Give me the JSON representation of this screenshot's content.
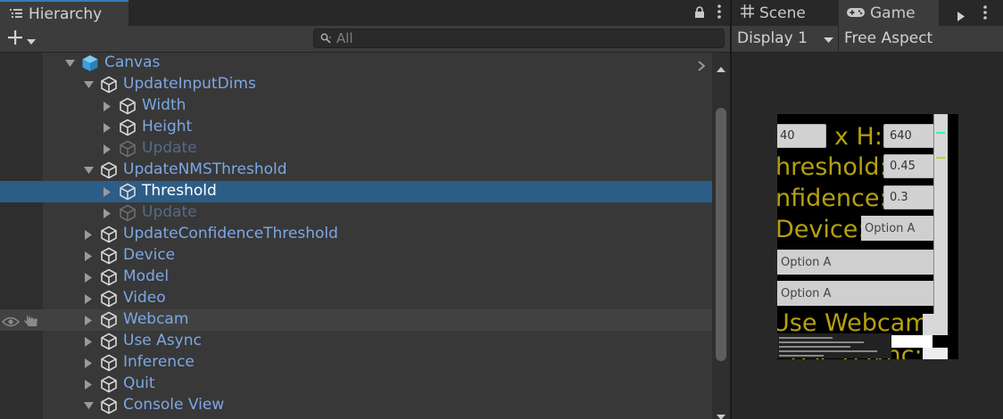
{
  "hierarchy": {
    "tab_title": "Hierarchy",
    "search_placeholder": "All",
    "rows": [
      {
        "name": "Canvas",
        "indent": 0,
        "fold": "open",
        "icon": "canvas-icon",
        "state": "normal"
      },
      {
        "name": "UpdateInputDims",
        "indent": 1,
        "fold": "open",
        "icon": "gameobject-icon",
        "state": "normal"
      },
      {
        "name": "Width",
        "indent": 2,
        "fold": "closed",
        "icon": "gameobject-icon",
        "state": "normal"
      },
      {
        "name": "Height",
        "indent": 2,
        "fold": "closed",
        "icon": "gameobject-icon",
        "state": "normal"
      },
      {
        "name": "Update",
        "indent": 2,
        "fold": "closed",
        "icon": "gameobject-icon",
        "state": "disabled"
      },
      {
        "name": "UpdateNMSThreshold",
        "indent": 1,
        "fold": "open",
        "icon": "gameobject-icon",
        "state": "normal"
      },
      {
        "name": "Threshold",
        "indent": 2,
        "fold": "closed",
        "icon": "gameobject-icon",
        "state": "selected"
      },
      {
        "name": "Update",
        "indent": 2,
        "fold": "closed",
        "icon": "gameobject-icon",
        "state": "disabled"
      },
      {
        "name": "UpdateConfidenceThreshold",
        "indent": 1,
        "fold": "closed",
        "icon": "gameobject-icon",
        "state": "normal"
      },
      {
        "name": "Device",
        "indent": 1,
        "fold": "closed",
        "icon": "gameobject-icon",
        "state": "normal"
      },
      {
        "name": "Model",
        "indent": 1,
        "fold": "closed",
        "icon": "gameobject-icon",
        "state": "normal"
      },
      {
        "name": "Video",
        "indent": 1,
        "fold": "closed",
        "icon": "gameobject-icon",
        "state": "normal"
      },
      {
        "name": "Webcam",
        "indent": 1,
        "fold": "closed",
        "icon": "gameobject-icon",
        "state": "hover"
      },
      {
        "name": "Use Async",
        "indent": 1,
        "fold": "closed",
        "icon": "gameobject-icon",
        "state": "normal"
      },
      {
        "name": "Inference",
        "indent": 1,
        "fold": "closed",
        "icon": "gameobject-icon",
        "state": "normal"
      },
      {
        "name": "Quit",
        "indent": 1,
        "fold": "closed",
        "icon": "gameobject-icon",
        "state": "normal"
      },
      {
        "name": "Console View",
        "indent": 1,
        "fold": "open",
        "icon": "gameobject-icon",
        "state": "normal"
      }
    ]
  },
  "game_view": {
    "tabs": [
      {
        "label": "Scene",
        "icon": "grid-icon"
      },
      {
        "label": "Game",
        "icon": "gamepad-icon"
      }
    ],
    "display": "Display 1",
    "aspect": "Free Aspect",
    "preview": {
      "dims_label": "x H:",
      "width_value": "40",
      "height_value": "640",
      "nms_label": "hreshold:",
      "nms_value": "0.45",
      "conf_label": "nfidence:",
      "conf_value": "0.3",
      "device_label": "Device:",
      "device_value": "Option A",
      "model_value": "Option A",
      "video_value": "Option A",
      "webcam_label": "Use Webcam:",
      "async_label": "Use Async:"
    }
  },
  "colors": {
    "selected_row": "#2c5d87",
    "name_text": "#7ca7e5",
    "disabled_text": "#56698a",
    "preview_label": "#b5a10e"
  }
}
